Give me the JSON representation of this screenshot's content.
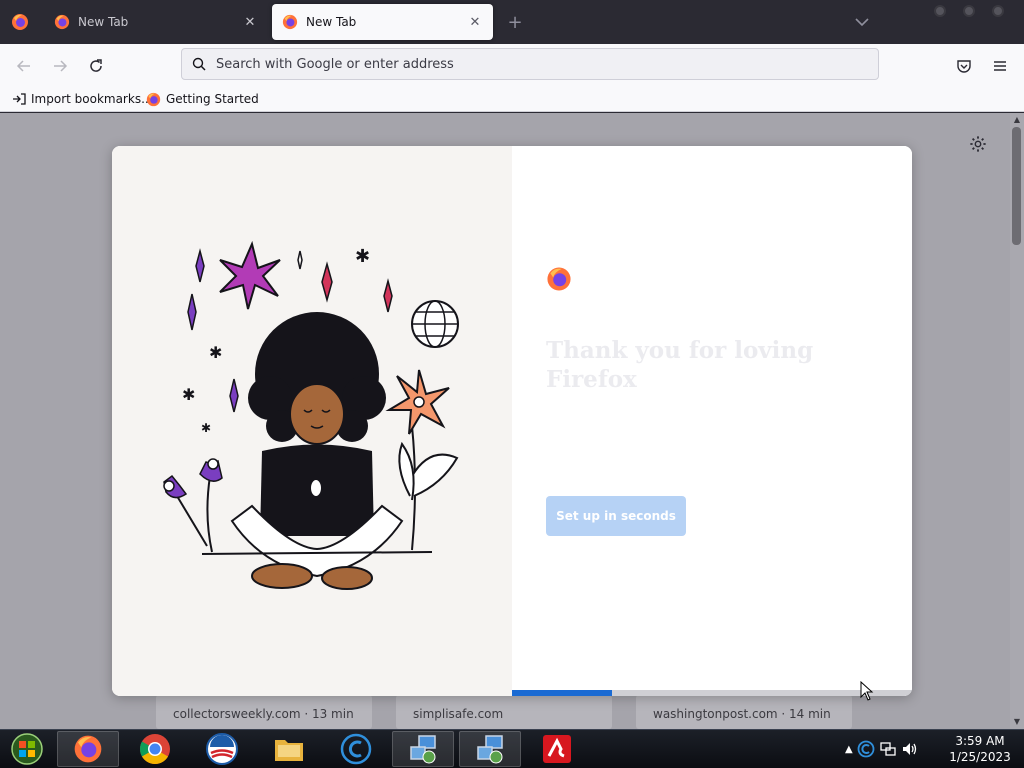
{
  "browser": {
    "tabs": [
      {
        "title": "New Tab",
        "active": false
      },
      {
        "title": "New Tab",
        "active": true
      }
    ],
    "address_bar": {
      "placeholder": "Search with Google or enter address",
      "value": ""
    },
    "bookmarks": [
      {
        "label": "Import bookmarks...",
        "icon": "import-icon"
      },
      {
        "label": "Getting Started",
        "icon": "firefox-icon"
      }
    ]
  },
  "new_tab_page": {
    "top_sites": [
      {
        "meta": "collectorsweekly.com · 13 min"
      },
      {
        "meta": "simplisafe.com"
      },
      {
        "meta": "washingtonpost.com · 14 min"
      }
    ]
  },
  "onboarding": {
    "title": "Thank you for loving Firefox",
    "description": "",
    "primary_button": "Set up in seconds",
    "progress": 0.25
  },
  "taskbar": {
    "items": [
      "firefox",
      "chrome",
      "obama-campaign",
      "file-explorer",
      "ccleaner",
      "network-tool-1",
      "network-tool-2",
      "avira"
    ],
    "clock_time": "3:59 AM",
    "clock_date": "1/25/2023"
  },
  "colors": {
    "accent": "#1a6ad3",
    "tabstrip": "#2b2a33",
    "content_overlay": "#a5a4ab"
  }
}
